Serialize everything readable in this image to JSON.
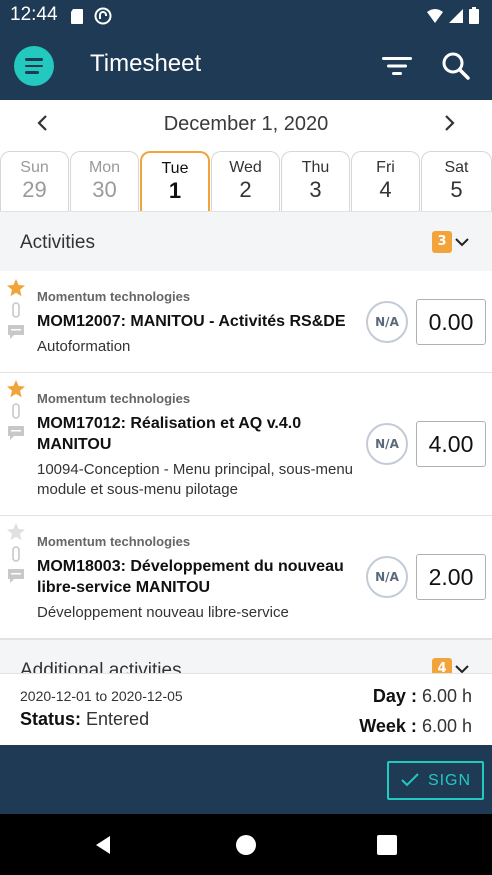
{
  "status_bar": {
    "time": "12:44"
  },
  "app_bar": {
    "title": "Timesheet"
  },
  "date_nav": {
    "label": "December 1, 2020"
  },
  "days": [
    {
      "name": "Sun",
      "num": "29"
    },
    {
      "name": "Mon",
      "num": "30"
    },
    {
      "name": "Tue",
      "num": "1"
    },
    {
      "name": "Wed",
      "num": "2"
    },
    {
      "name": "Thu",
      "num": "3"
    },
    {
      "name": "Fri",
      "num": "4"
    },
    {
      "name": "Sat",
      "num": "5"
    }
  ],
  "activities_section": {
    "label": "Activities",
    "count": "3"
  },
  "activities": [
    {
      "company": "Momentum technologies",
      "title": "MOM12007: MANITOU - Activités RS&DE",
      "description": "Autoformation",
      "na": "N/A",
      "hours": "0.00",
      "favorite": true
    },
    {
      "company": "Momentum technologies",
      "title": "MOM17012: Réalisation et AQ v.4.0 MANITOU",
      "description": "10094-Conception - Menu principal, sous-menu module et sous-menu pilotage",
      "na": "N/A",
      "hours": "4.00",
      "favorite": true
    },
    {
      "company": "Momentum technologies",
      "title": "MOM18003: Développement du nouveau libre-service MANITOU",
      "description": "Développement nouveau libre-service",
      "na": "N/A",
      "hours": "2.00",
      "favorite": false
    }
  ],
  "additional_section": {
    "label": "Additional activities",
    "count": "4"
  },
  "summary": {
    "range": "2020-12-01 to 2020-12-05",
    "status_label": "Status:",
    "status_value": "Entered",
    "day_label": "Day :",
    "day_value": "6.00 h",
    "week_label": "Week :",
    "week_value": "6.00 h"
  },
  "footer": {
    "sign_label": "SIGN"
  },
  "colors": {
    "primary": "#1f3a55",
    "accent": "#23c8bf",
    "highlight": "#f0a43a"
  }
}
